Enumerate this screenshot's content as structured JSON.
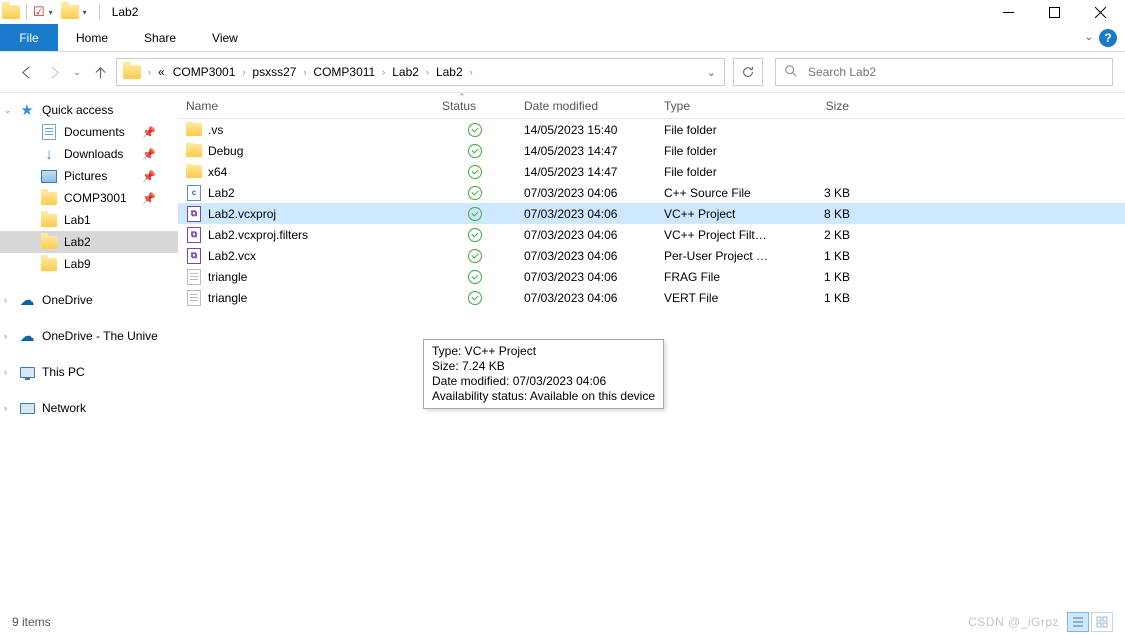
{
  "window": {
    "title": "Lab2"
  },
  "ribbon": {
    "file_tab": "File",
    "tabs": [
      "Home",
      "Share",
      "View"
    ]
  },
  "breadcrumb": {
    "overflow": "«",
    "segments": [
      "COMP3001",
      "psxss27",
      "COMP3011",
      "Lab2",
      "Lab2"
    ]
  },
  "search": {
    "placeholder": "Search Lab2"
  },
  "nav": {
    "quick_access": "Quick access",
    "pinned": [
      {
        "label": "Documents",
        "icon": "documents"
      },
      {
        "label": "Downloads",
        "icon": "downloads"
      },
      {
        "label": "Pictures",
        "icon": "pictures"
      },
      {
        "label": "COMP3001",
        "icon": "folder"
      }
    ],
    "recent": [
      {
        "label": "Lab1"
      },
      {
        "label": "Lab2",
        "selected": true
      },
      {
        "label": "Lab9"
      }
    ],
    "others": [
      {
        "label": "OneDrive",
        "icon": "cloud"
      },
      {
        "label": "OneDrive - The Unive",
        "icon": "cloud"
      },
      {
        "label": "This PC",
        "icon": "pc"
      },
      {
        "label": "Network",
        "icon": "network"
      }
    ]
  },
  "columns": {
    "name": "Name",
    "status": "Status",
    "date": "Date modified",
    "type": "Type",
    "size": "Size"
  },
  "files": [
    {
      "name": ".vs",
      "icon": "folder",
      "date": "14/05/2023 15:40",
      "type": "File folder",
      "size": ""
    },
    {
      "name": "Debug",
      "icon": "folder",
      "date": "14/05/2023 14:47",
      "type": "File folder",
      "size": ""
    },
    {
      "name": "x64",
      "icon": "folder",
      "date": "14/05/2023 14:47",
      "type": "File folder",
      "size": ""
    },
    {
      "name": "Lab2",
      "icon": "cpp",
      "date": "07/03/2023 04:06",
      "type": "C++ Source File",
      "size": "3 KB"
    },
    {
      "name": "Lab2.vcxproj",
      "icon": "vcx",
      "date": "07/03/2023 04:06",
      "type": "VC++ Project",
      "size": "8 KB",
      "selected": true
    },
    {
      "name": "Lab2.vcxproj.filters",
      "icon": "vcx",
      "date": "07/03/2023 04:06",
      "type": "VC++ Project Filte...",
      "size": "2 KB"
    },
    {
      "name": "Lab2.vcx",
      "icon": "vcx",
      "date": "07/03/2023 04:06",
      "type": "Per-User Project O...",
      "size": "1 KB"
    },
    {
      "name": "triangle",
      "icon": "txt",
      "date": "07/03/2023 04:06",
      "type": "FRAG File",
      "size": "1 KB"
    },
    {
      "name": "triangle",
      "icon": "txt",
      "date": "07/03/2023 04:06",
      "type": "VERT File",
      "size": "1 KB"
    }
  ],
  "tooltip": {
    "line1": "Type: VC++ Project",
    "line2": "Size: 7.24 KB",
    "line3": "Date modified: 07/03/2023 04:06",
    "line4": "Availability status: Available on this device"
  },
  "status": {
    "items": "9 items",
    "watermark": "CSDN @_iGrpz"
  }
}
